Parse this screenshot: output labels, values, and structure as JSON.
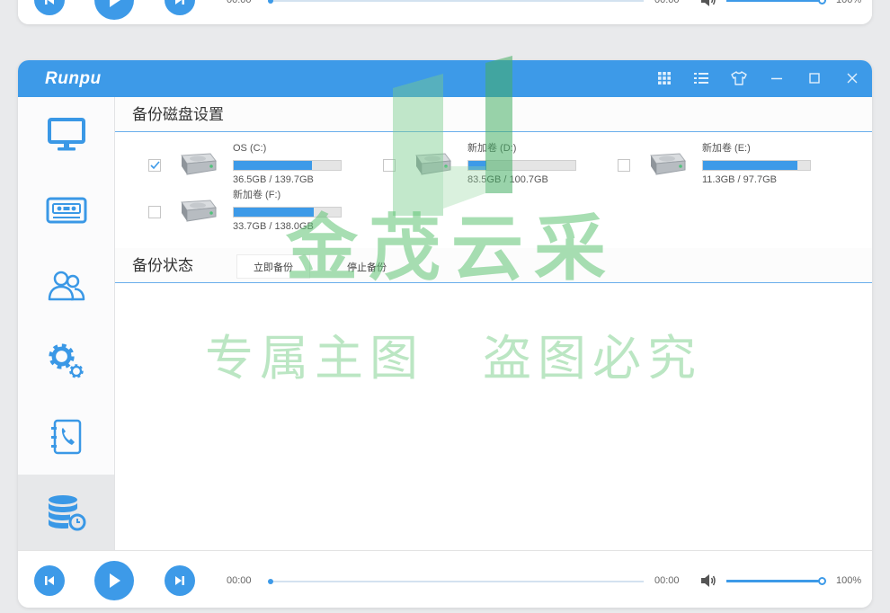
{
  "app": {
    "logo": "Runpu"
  },
  "titlebar": {
    "buttons": [
      "grid-icon",
      "list-icon",
      "skin-icon",
      "minimize-icon",
      "maximize-icon",
      "close-icon"
    ]
  },
  "sidebar": {
    "items": [
      {
        "icon": "monitor-icon",
        "selected": false
      },
      {
        "icon": "cassette-icon",
        "selected": false
      },
      {
        "icon": "users-icon",
        "selected": false
      },
      {
        "icon": "gears-icon",
        "selected": false
      },
      {
        "icon": "phone-book-icon",
        "selected": false
      },
      {
        "icon": "database-icon",
        "selected": true
      }
    ]
  },
  "disk_settings": {
    "title": "备份磁盘设置",
    "disks": [
      {
        "label": "OS (C:)",
        "size": "36.5GB / 139.7GB",
        "checked": true,
        "fill": 0.73
      },
      {
        "label": "新加卷 (D:)",
        "size": "83.5GB / 100.7GB",
        "checked": false,
        "fill": 0.17
      },
      {
        "label": "新加卷 (E:)",
        "size": "11.3GB / 97.7GB",
        "checked": false,
        "fill": 0.88
      },
      {
        "label": "新加卷 (F:)",
        "size": "33.7GB / 138.0GB",
        "checked": false,
        "fill": 0.75
      }
    ]
  },
  "backup_status": {
    "title": "备份状态",
    "start_button": "立即备份",
    "stop_button": "停止备份"
  },
  "player": {
    "current_time": "00:00",
    "total_time": "00:00",
    "progress": 0,
    "volume": 1.0,
    "volume_label": "100%"
  },
  "watermark": {
    "brand": "金茂云采",
    "line1": "专属主图",
    "line2": "盗图必究"
  },
  "colors": {
    "accent": "#3d9ae8",
    "watermark": "#5fc373",
    "page_background": "#e9eaec"
  }
}
